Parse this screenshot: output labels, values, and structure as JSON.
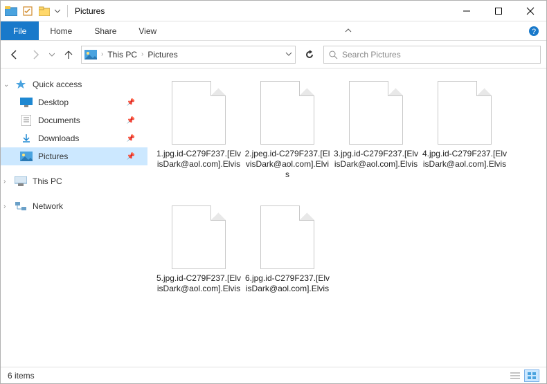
{
  "window": {
    "title": "Pictures"
  },
  "ribbon": {
    "file": "File",
    "tabs": [
      "Home",
      "Share",
      "View"
    ]
  },
  "address": {
    "crumbs": [
      "This PC",
      "Pictures"
    ]
  },
  "search": {
    "placeholder": "Search Pictures"
  },
  "sidebar": {
    "quick_access": "Quick access",
    "pinned": [
      {
        "label": "Desktop",
        "icon": "desktop"
      },
      {
        "label": "Documents",
        "icon": "documents"
      },
      {
        "label": "Downloads",
        "icon": "downloads"
      },
      {
        "label": "Pictures",
        "icon": "pictures",
        "selected": true
      }
    ],
    "this_pc": "This PC",
    "network": "Network"
  },
  "files": [
    {
      "name": "1.jpg.id-C279F237.[ElvisDark@aol.com].Elvis"
    },
    {
      "name": "2.jpeg.id-C279F237.[ElvisDark@aol.com].Elvis"
    },
    {
      "name": "3.jpg.id-C279F237.[ElvisDark@aol.com].Elvis"
    },
    {
      "name": "4.jpg.id-C279F237.[ElvisDark@aol.com].Elvis"
    },
    {
      "name": "5.jpg.id-C279F237.[ElvisDark@aol.com].Elvis"
    },
    {
      "name": "6.jpg.id-C279F237.[ElvisDark@aol.com].Elvis"
    }
  ],
  "status": {
    "text": "6 items"
  }
}
